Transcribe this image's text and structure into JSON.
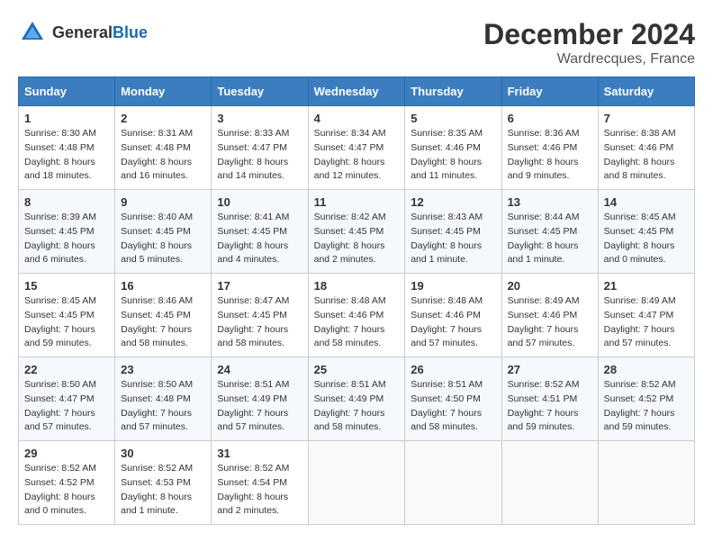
{
  "header": {
    "logo_general": "General",
    "logo_blue": "Blue",
    "month_title": "December 2024",
    "location": "Wardrecques, France"
  },
  "days_of_week": [
    "Sunday",
    "Monday",
    "Tuesday",
    "Wednesday",
    "Thursday",
    "Friday",
    "Saturday"
  ],
  "weeks": [
    [
      {
        "day": "1",
        "sunrise": "Sunrise: 8:30 AM",
        "sunset": "Sunset: 4:48 PM",
        "daylight": "Daylight: 8 hours and 18 minutes."
      },
      {
        "day": "2",
        "sunrise": "Sunrise: 8:31 AM",
        "sunset": "Sunset: 4:48 PM",
        "daylight": "Daylight: 8 hours and 16 minutes."
      },
      {
        "day": "3",
        "sunrise": "Sunrise: 8:33 AM",
        "sunset": "Sunset: 4:47 PM",
        "daylight": "Daylight: 8 hours and 14 minutes."
      },
      {
        "day": "4",
        "sunrise": "Sunrise: 8:34 AM",
        "sunset": "Sunset: 4:47 PM",
        "daylight": "Daylight: 8 hours and 12 minutes."
      },
      {
        "day": "5",
        "sunrise": "Sunrise: 8:35 AM",
        "sunset": "Sunset: 4:46 PM",
        "daylight": "Daylight: 8 hours and 11 minutes."
      },
      {
        "day": "6",
        "sunrise": "Sunrise: 8:36 AM",
        "sunset": "Sunset: 4:46 PM",
        "daylight": "Daylight: 8 hours and 9 minutes."
      },
      {
        "day": "7",
        "sunrise": "Sunrise: 8:38 AM",
        "sunset": "Sunset: 4:46 PM",
        "daylight": "Daylight: 8 hours and 8 minutes."
      }
    ],
    [
      {
        "day": "8",
        "sunrise": "Sunrise: 8:39 AM",
        "sunset": "Sunset: 4:45 PM",
        "daylight": "Daylight: 8 hours and 6 minutes."
      },
      {
        "day": "9",
        "sunrise": "Sunrise: 8:40 AM",
        "sunset": "Sunset: 4:45 PM",
        "daylight": "Daylight: 8 hours and 5 minutes."
      },
      {
        "day": "10",
        "sunrise": "Sunrise: 8:41 AM",
        "sunset": "Sunset: 4:45 PM",
        "daylight": "Daylight: 8 hours and 4 minutes."
      },
      {
        "day": "11",
        "sunrise": "Sunrise: 8:42 AM",
        "sunset": "Sunset: 4:45 PM",
        "daylight": "Daylight: 8 hours and 2 minutes."
      },
      {
        "day": "12",
        "sunrise": "Sunrise: 8:43 AM",
        "sunset": "Sunset: 4:45 PM",
        "daylight": "Daylight: 8 hours and 1 minute."
      },
      {
        "day": "13",
        "sunrise": "Sunrise: 8:44 AM",
        "sunset": "Sunset: 4:45 PM",
        "daylight": "Daylight: 8 hours and 1 minute."
      },
      {
        "day": "14",
        "sunrise": "Sunrise: 8:45 AM",
        "sunset": "Sunset: 4:45 PM",
        "daylight": "Daylight: 8 hours and 0 minutes."
      }
    ],
    [
      {
        "day": "15",
        "sunrise": "Sunrise: 8:45 AM",
        "sunset": "Sunset: 4:45 PM",
        "daylight": "Daylight: 7 hours and 59 minutes."
      },
      {
        "day": "16",
        "sunrise": "Sunrise: 8:46 AM",
        "sunset": "Sunset: 4:45 PM",
        "daylight": "Daylight: 7 hours and 58 minutes."
      },
      {
        "day": "17",
        "sunrise": "Sunrise: 8:47 AM",
        "sunset": "Sunset: 4:45 PM",
        "daylight": "Daylight: 7 hours and 58 minutes."
      },
      {
        "day": "18",
        "sunrise": "Sunrise: 8:48 AM",
        "sunset": "Sunset: 4:46 PM",
        "daylight": "Daylight: 7 hours and 58 minutes."
      },
      {
        "day": "19",
        "sunrise": "Sunrise: 8:48 AM",
        "sunset": "Sunset: 4:46 PM",
        "daylight": "Daylight: 7 hours and 57 minutes."
      },
      {
        "day": "20",
        "sunrise": "Sunrise: 8:49 AM",
        "sunset": "Sunset: 4:46 PM",
        "daylight": "Daylight: 7 hours and 57 minutes."
      },
      {
        "day": "21",
        "sunrise": "Sunrise: 8:49 AM",
        "sunset": "Sunset: 4:47 PM",
        "daylight": "Daylight: 7 hours and 57 minutes."
      }
    ],
    [
      {
        "day": "22",
        "sunrise": "Sunrise: 8:50 AM",
        "sunset": "Sunset: 4:47 PM",
        "daylight": "Daylight: 7 hours and 57 minutes."
      },
      {
        "day": "23",
        "sunrise": "Sunrise: 8:50 AM",
        "sunset": "Sunset: 4:48 PM",
        "daylight": "Daylight: 7 hours and 57 minutes."
      },
      {
        "day": "24",
        "sunrise": "Sunrise: 8:51 AM",
        "sunset": "Sunset: 4:49 PM",
        "daylight": "Daylight: 7 hours and 57 minutes."
      },
      {
        "day": "25",
        "sunrise": "Sunrise: 8:51 AM",
        "sunset": "Sunset: 4:49 PM",
        "daylight": "Daylight: 7 hours and 58 minutes."
      },
      {
        "day": "26",
        "sunrise": "Sunrise: 8:51 AM",
        "sunset": "Sunset: 4:50 PM",
        "daylight": "Daylight: 7 hours and 58 minutes."
      },
      {
        "day": "27",
        "sunrise": "Sunrise: 8:52 AM",
        "sunset": "Sunset: 4:51 PM",
        "daylight": "Daylight: 7 hours and 59 minutes."
      },
      {
        "day": "28",
        "sunrise": "Sunrise: 8:52 AM",
        "sunset": "Sunset: 4:52 PM",
        "daylight": "Daylight: 7 hours and 59 minutes."
      }
    ],
    [
      {
        "day": "29",
        "sunrise": "Sunrise: 8:52 AM",
        "sunset": "Sunset: 4:52 PM",
        "daylight": "Daylight: 8 hours and 0 minutes."
      },
      {
        "day": "30",
        "sunrise": "Sunrise: 8:52 AM",
        "sunset": "Sunset: 4:53 PM",
        "daylight": "Daylight: 8 hours and 1 minute."
      },
      {
        "day": "31",
        "sunrise": "Sunrise: 8:52 AM",
        "sunset": "Sunset: 4:54 PM",
        "daylight": "Daylight: 8 hours and 2 minutes."
      },
      null,
      null,
      null,
      null
    ]
  ]
}
